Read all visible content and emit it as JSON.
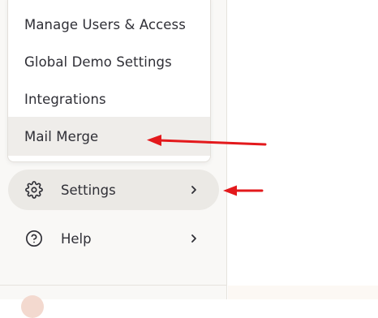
{
  "submenu": {
    "items": [
      {
        "label": "Manage Users & Access"
      },
      {
        "label": "Global Demo Settings"
      },
      {
        "label": "Integrations"
      },
      {
        "label": "Mail Merge"
      }
    ]
  },
  "nav": {
    "settings": {
      "label": "Settings",
      "icon": "gear-icon"
    },
    "help": {
      "label": "Help",
      "icon": "help-circle-icon"
    }
  },
  "colors": {
    "annotation_arrow": "#e3191c",
    "active_item_bg": "#ebe9e5",
    "text": "#2f2f36"
  }
}
